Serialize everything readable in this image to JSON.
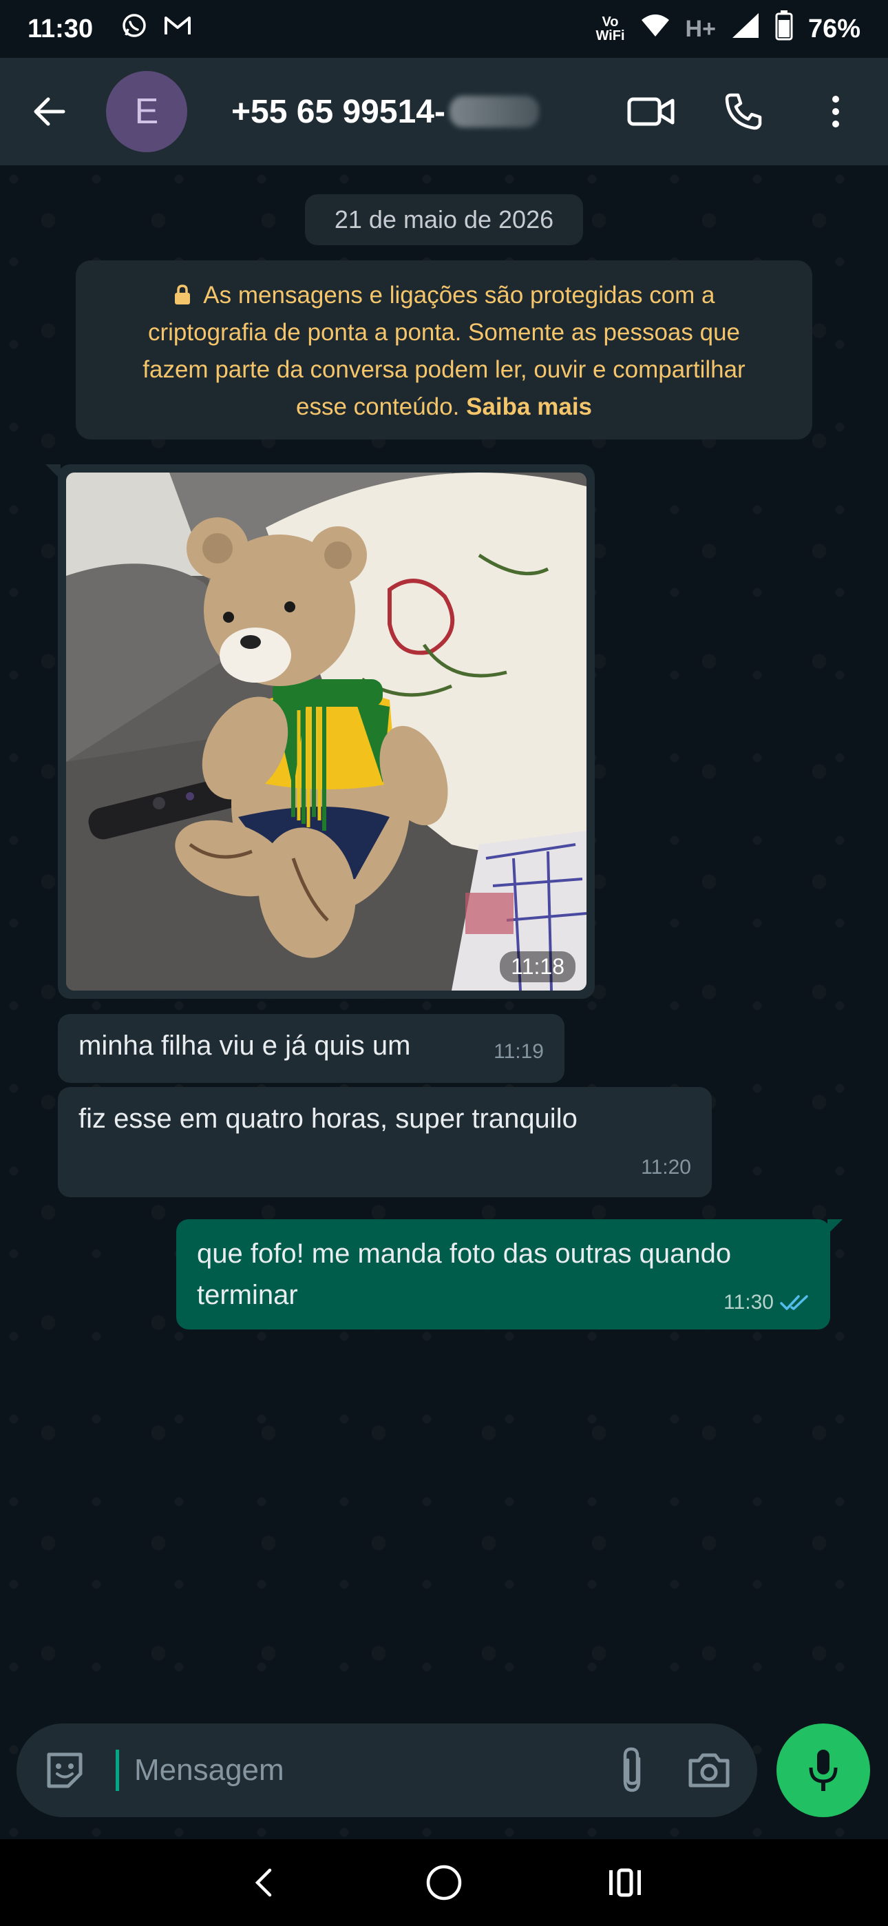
{
  "status_bar": {
    "time": "11:30",
    "vowifi_label": "Vo\nWiFi",
    "network_label": "H+",
    "battery": "76%",
    "icons": [
      "whatsapp-icon",
      "gmail-icon",
      "wifi-icon",
      "signal-icon",
      "battery-icon"
    ]
  },
  "header": {
    "avatar_letter": "E",
    "contact_name": "+55 65 99514-",
    "icons": [
      "back-arrow-icon",
      "video-call-icon",
      "phone-icon",
      "more-vert-icon"
    ]
  },
  "chat": {
    "date_chip": "21 de maio de 2026",
    "e2e_notice": {
      "text": "As mensagens e ligações são protegidas com a criptografia de ponta a ponta. Somente as pessoas que fazem parte da conversa podem ler, ouvir e compartilhar esse conteúdo.",
      "link": "Saiba mais"
    },
    "messages": [
      {
        "type": "image",
        "direction": "in",
        "time": "11:18"
      },
      {
        "type": "text",
        "direction": "in",
        "text": "minha filha viu e já quis um",
        "time": "11:19"
      },
      {
        "type": "text",
        "direction": "in",
        "text": "fiz esse em quatro horas, super tranquilo",
        "time": "11:20"
      },
      {
        "type": "text",
        "direction": "out",
        "text": "que fofo! me manda foto das outras quando terminar",
        "time": "11:30",
        "status": "read"
      }
    ]
  },
  "composer": {
    "placeholder": "Mensagem",
    "icons": [
      "sticker-icon",
      "attach-icon",
      "camera-icon",
      "mic-icon"
    ]
  },
  "colors": {
    "background": "#0b141a",
    "header": "#1f2c34",
    "incoming_bubble": "#1f2c34",
    "outgoing_bubble": "#005c4b",
    "notice_text": "#f5c56b",
    "mic_button": "#21c063",
    "read_ticks": "#53bdeb"
  }
}
